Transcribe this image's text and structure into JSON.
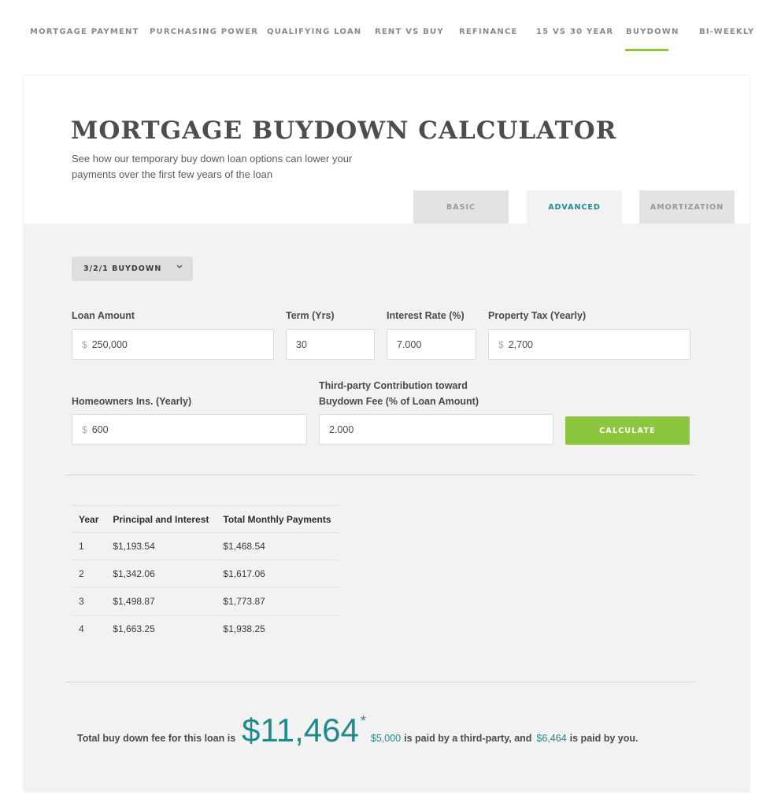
{
  "nav": {
    "items": [
      {
        "label": "MORTGAGE PAYMENT"
      },
      {
        "label": "PURCHASING POWER"
      },
      {
        "label": "QUALIFYING LOAN"
      },
      {
        "label": "RENT VS BUY"
      },
      {
        "label": "REFINANCE"
      },
      {
        "label": "15 VS 30 YEAR"
      },
      {
        "label": "BUYDOWN"
      },
      {
        "label": "BI-WEEKLY"
      }
    ],
    "active": "BUYDOWN",
    "accent_color": "#8cc63f"
  },
  "header": {
    "title": "MORTGAGE BUYDOWN CALCULATOR",
    "subtitle": "See how our temporary buy down loan options can lower your payments over the first few years of the loan"
  },
  "tabs": {
    "basic": "BASIC",
    "advanced": "ADVANCED",
    "amortization": "AMORTIZATION",
    "active": "ADVANCED"
  },
  "form": {
    "buydown_type": "3/2/1 BUYDOWN",
    "loan_amount": {
      "label": "Loan Amount",
      "prefix": "$",
      "value": "250,000"
    },
    "term": {
      "label": "Term (Yrs)",
      "value": "30"
    },
    "interest_rate": {
      "label": "Interest Rate (%)",
      "value": "7.000"
    },
    "property_tax": {
      "label": "Property Tax (Yearly)",
      "prefix": "$",
      "value": "2,700"
    },
    "homeowners_ins": {
      "label": "Homeowners Ins. (Yearly)",
      "prefix": "$",
      "value": "600"
    },
    "contribution": {
      "label_line1": "Third-party Contribution toward",
      "label_line2": "Buydown Fee (% of Loan Amount)",
      "value": "2.000"
    },
    "calculate_label": "CALCULATE"
  },
  "results": {
    "headers": [
      "Year",
      "Principal and Interest",
      "Total Monthly Payments"
    ],
    "rows": [
      [
        "1",
        "$1,193.54",
        "$1,468.54"
      ],
      [
        "2",
        "$1,342.06",
        "$1,617.06"
      ],
      [
        "3",
        "$1,498.87",
        "$1,773.87"
      ],
      [
        "4",
        "$1,663.25",
        "$1,938.25"
      ]
    ]
  },
  "summary": {
    "prefix_text": "Total buy down fee for this loan is",
    "total_fee": "$11,464",
    "asterisk": "*",
    "third_party_amount": "$5,000",
    "middle_text": "is paid by a third-party, and",
    "you_amount": "$6,464",
    "suffix_text": "is paid by you.",
    "accent_color": "#1f8a8f"
  }
}
